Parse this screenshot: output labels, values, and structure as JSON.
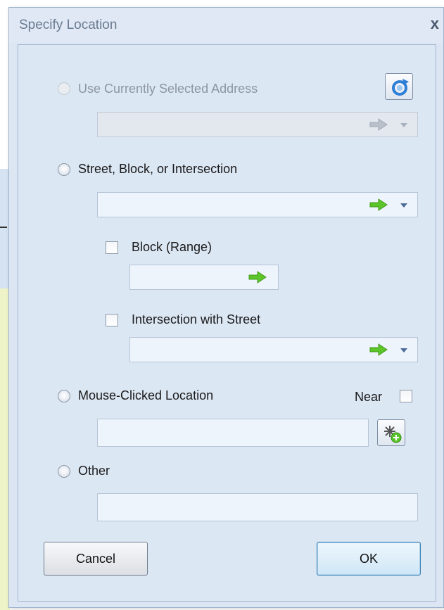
{
  "window": {
    "title": "Specify Location",
    "close_glyph": "x"
  },
  "options": {
    "current_address": {
      "label": "Use Currently Selected Address",
      "enabled": false,
      "value": ""
    },
    "street": {
      "label": "Street, Block, or Intersection",
      "value": ""
    },
    "block": {
      "label": "Block (Range)",
      "checked": false,
      "value": ""
    },
    "intersection": {
      "label": "Intersection with Street",
      "checked": false,
      "value": ""
    },
    "mouse": {
      "label": "Mouse-Clicked Location",
      "near_label": "Near",
      "near_checked": false,
      "value": ""
    },
    "other": {
      "label": "Other",
      "value": ""
    }
  },
  "buttons": {
    "cancel": "Cancel",
    "ok": "OK"
  },
  "colors": {
    "arrow_active": "#5cc52a",
    "arrow_disabled": "#b9c0c9",
    "refresh_icon": "#2f7fd6"
  }
}
